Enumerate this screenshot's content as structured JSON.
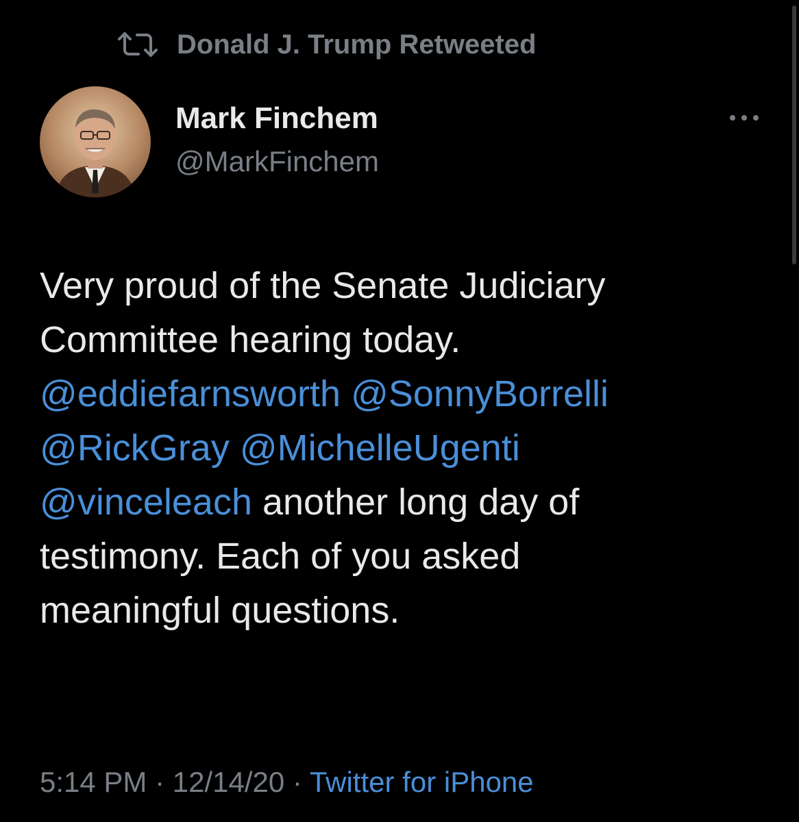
{
  "retweet": {
    "icon": "retweet-icon",
    "text": "Donald J. Trump Retweeted"
  },
  "author": {
    "name": "Mark Finchem",
    "handle": "@MarkFinchem",
    "avatar_icon": "avatar-photo"
  },
  "more_icon": "more-horizontal-icon",
  "tweet": {
    "line1": "Very proud of the Senate Judiciary",
    "line2": "Committee hearing today.",
    "mentions": [
      "@eddiefarnsworth",
      "@SonnyBorrelli",
      "@RickGray",
      "@MichelleUgenti",
      "@vinceleach"
    ],
    "text_after_mentions_line5": " another long day of",
    "line6": "testimony. Each of you asked",
    "line7": "meaningful questions."
  },
  "meta": {
    "time": "5:14 PM",
    "separator": " · ",
    "date": "12/14/20",
    "source": "Twitter for iPhone"
  },
  "colors": {
    "background": "#000000",
    "text": "#e7e9ea",
    "secondary": "#7a7f86",
    "link": "#4a8fd8"
  }
}
